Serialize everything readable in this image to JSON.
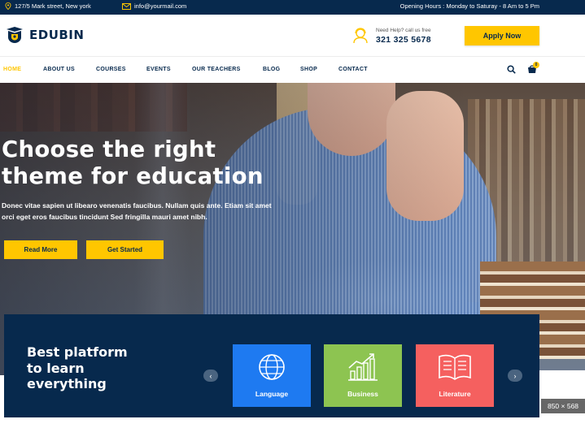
{
  "topbar": {
    "address": "127/5 Mark street, New york",
    "email": "info@yourmail.com",
    "hours": "Opening Hours : Monday to Saturay - 8 Am to 5 Pm"
  },
  "header": {
    "logo_text": "EDUBIN",
    "help_label": "Need Help? call us free",
    "phone": "321 325 5678",
    "apply_label": "Apply Now"
  },
  "nav": {
    "items": [
      "HOME",
      "ABOUT US",
      "COURSES",
      "EVENTS",
      "OUR TEACHERS",
      "BLOG",
      "SHOP",
      "CONTACT"
    ],
    "active": "HOME",
    "cart_count": "0"
  },
  "hero": {
    "title_line1": "Choose the right",
    "title_line2": "theme for education",
    "text_line1": "Donec vitae sapien ut libearo venenatis faucibus. Nullam quis ante. Etiam sit amet",
    "text_line2": "orci eget eros faucibus tincidunt Sed fringilla mauri amet nibh.",
    "read_more": "Read More",
    "get_started": "Get Started"
  },
  "platform": {
    "title_line1": "Best platform",
    "title_line2": "to learn",
    "title_line3": "everything",
    "arrow_left": "‹",
    "arrow_right": "›",
    "categories": [
      {
        "label": "Language",
        "icon": "globe-icon",
        "color": "#1e7af1"
      },
      {
        "label": "Business",
        "icon": "growth-chart-icon",
        "color": "#8dc451"
      },
      {
        "label": "Literature",
        "icon": "open-book-icon",
        "color": "#f5605f"
      }
    ]
  },
  "image_size_badge": "850 × 568",
  "colors": {
    "navy": "#07294d",
    "accent": "#ffc600"
  }
}
